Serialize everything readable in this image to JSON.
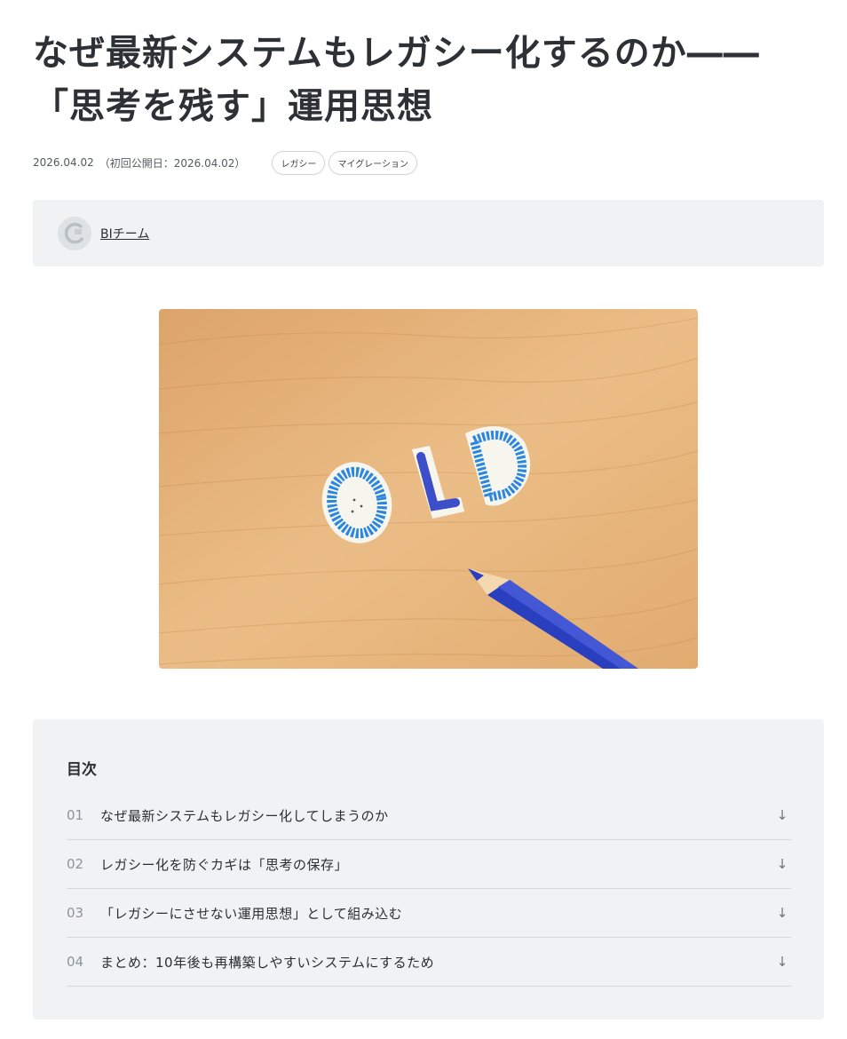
{
  "article": {
    "title_line1": "なぜ最新システムもレガシー化するのか――",
    "title_line2": "「思考を残す」運用思想",
    "date": "2026.04.02",
    "first_published": "（初回公開日：2026.04.02）",
    "tags": [
      "レガシー",
      "マイグレーション"
    ]
  },
  "author": {
    "name": "BIチーム",
    "avatar_icon": "avatar-logo-icon"
  },
  "hero_image": {
    "text": "OLD"
  },
  "toc": {
    "heading": "目次",
    "arrow_icon": "arrow-down-icon",
    "items": [
      {
        "num": "01",
        "label": "なぜ最新システムもレガシー化してしまうのか",
        "arrow": "↓"
      },
      {
        "num": "02",
        "label": "レガシー化を防ぐカギは「思考の保存」",
        "arrow": "↓"
      },
      {
        "num": "03",
        "label": "「レガシーにさせない運用思想」として組み込む",
        "arrow": "↓"
      },
      {
        "num": "04",
        "label": "まとめ：10年後も再構築しやすいシステムにするため",
        "arrow": "↓"
      }
    ]
  },
  "colors": {
    "box_bg": "#f1f2f4",
    "wood": "#e4b27a",
    "bead_blue": "#2a86e0",
    "pencil_blue": "#2a3fbf"
  }
}
